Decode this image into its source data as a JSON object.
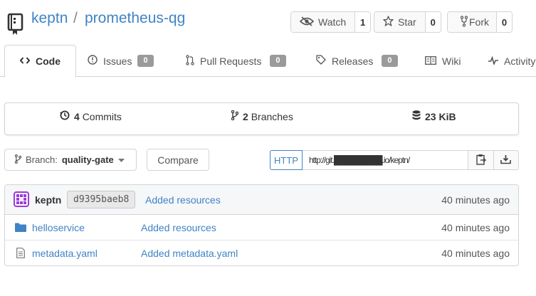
{
  "repo": {
    "owner": "keptn",
    "separator": "/",
    "name": "prometheus-qg"
  },
  "actions": {
    "watch_label": "Watch",
    "watch_count": "1",
    "star_label": "Star",
    "star_count": "0",
    "fork_label": "Fork",
    "fork_count": "0"
  },
  "tabs": [
    {
      "label": "Code",
      "icon": "code-icon"
    },
    {
      "label": "Issues",
      "count": "0",
      "icon": "issue-icon"
    },
    {
      "label": "Pull Requests",
      "count": "0",
      "icon": "pull-request-icon"
    },
    {
      "label": "Releases",
      "count": "0",
      "icon": "tag-icon"
    },
    {
      "label": "Wiki",
      "icon": "book-icon"
    },
    {
      "label": "Activity",
      "icon": "pulse-icon"
    }
  ],
  "stats": {
    "commits_count": "4",
    "commits_label": "Commits",
    "branches_count": "2",
    "branches_label": "Branches",
    "size": "23 KiB"
  },
  "branch": {
    "prefix": "Branch:",
    "name": "quality-gate"
  },
  "compare_label": "Compare",
  "clone": {
    "protocol": "HTTP",
    "url": "http://git.█████████.io/keptn/"
  },
  "latest_commit": {
    "author": "keptn",
    "sha": "d9395baeb8",
    "message": "Added resources",
    "time": "40 minutes ago"
  },
  "files": [
    {
      "name": "helloservice",
      "type": "folder",
      "message": "Added resources",
      "time": "40 minutes ago"
    },
    {
      "name": "metadata.yaml",
      "type": "file",
      "message": "Added metadata.yaml",
      "time": "40 minutes ago"
    }
  ],
  "colors": {
    "link": "#4183c4",
    "badge": "#9a9a9a",
    "avatar": "#9b3bd8"
  }
}
